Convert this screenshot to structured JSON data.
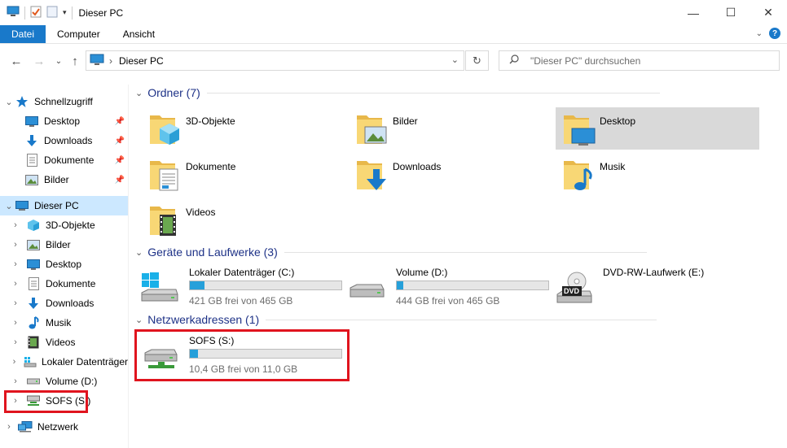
{
  "window": {
    "title": "Dieser PC",
    "controls": {
      "minimize": "—",
      "maximize": "☐",
      "close": "✕"
    }
  },
  "ribbon": {
    "tabs": [
      {
        "label": "Datei",
        "active": true
      },
      {
        "label": "Computer",
        "active": false
      },
      {
        "label": "Ansicht",
        "active": false
      }
    ],
    "help_label": "?"
  },
  "address": {
    "path": "Dieser PC",
    "search_placeholder": "\"Dieser PC\" durchsuchen"
  },
  "sidebar": {
    "items": [
      {
        "label": "Schnellzugriff",
        "icon": "star-icon",
        "level": 0,
        "chevron": "open"
      },
      {
        "label": "Desktop",
        "icon": "desktop-icon",
        "level": 1,
        "pinned": true
      },
      {
        "label": "Downloads",
        "icon": "downloads-icon",
        "level": 1,
        "pinned": true
      },
      {
        "label": "Dokumente",
        "icon": "documents-icon",
        "level": 1,
        "pinned": true
      },
      {
        "label": "Bilder",
        "icon": "pictures-icon",
        "level": 1,
        "pinned": true
      },
      {
        "label": "Dieser PC",
        "icon": "computer-icon",
        "level": 0,
        "chevron": "open",
        "selected": true
      },
      {
        "label": "3D-Objekte",
        "icon": "3d-objects-icon",
        "level": 1,
        "chevron": "closed"
      },
      {
        "label": "Bilder",
        "icon": "pictures-icon",
        "level": 1,
        "chevron": "closed"
      },
      {
        "label": "Desktop",
        "icon": "desktop-icon",
        "level": 1,
        "chevron": "closed"
      },
      {
        "label": "Dokumente",
        "icon": "documents-icon",
        "level": 1,
        "chevron": "closed"
      },
      {
        "label": "Downloads",
        "icon": "downloads-icon",
        "level": 1,
        "chevron": "closed"
      },
      {
        "label": "Musik",
        "icon": "music-icon",
        "level": 1,
        "chevron": "closed"
      },
      {
        "label": "Videos",
        "icon": "videos-icon",
        "level": 1,
        "chevron": "closed"
      },
      {
        "label": "Lokaler Datenträger",
        "icon": "local-disk-icon",
        "level": 1,
        "chevron": "closed"
      },
      {
        "label": "Volume (D:)",
        "icon": "drive-icon",
        "level": 1,
        "chevron": "closed"
      },
      {
        "label": "SOFS (S:)",
        "icon": "network-drive-icon",
        "level": 1,
        "chevron": "closed",
        "highlighted": true
      },
      {
        "label": "Netzwerk",
        "icon": "network-icon",
        "level": 0,
        "chevron": "closed"
      }
    ]
  },
  "groups": {
    "folders": {
      "title": "Ordner (7)",
      "items": [
        {
          "label": "3D-Objekte",
          "icon": "3d-objects-icon"
        },
        {
          "label": "Bilder",
          "icon": "pictures-icon"
        },
        {
          "label": "Desktop",
          "icon": "desktop-icon",
          "selected": true
        },
        {
          "label": "Dokumente",
          "icon": "documents-icon"
        },
        {
          "label": "Downloads",
          "icon": "downloads-icon"
        },
        {
          "label": "Musik",
          "icon": "music-icon"
        },
        {
          "label": "Videos",
          "icon": "videos-icon"
        }
      ]
    },
    "drives": {
      "title": "Geräte und Laufwerke (3)",
      "items": [
        {
          "label": "Lokaler Datenträger (C:)",
          "free": "421 GB frei von 465 GB",
          "used_fraction": 0.095,
          "icon": "windows-drive-icon",
          "bar": true
        },
        {
          "label": "Volume (D:)",
          "free": "444 GB frei von 465 GB",
          "used_fraction": 0.045,
          "icon": "drive-icon",
          "bar": true
        },
        {
          "label": "DVD-RW-Laufwerk (E:)",
          "free": "",
          "icon": "dvd-drive-icon",
          "bar": false,
          "dvd_label": "DVD"
        }
      ]
    },
    "network": {
      "title": "Netzwerkadressen (1)",
      "items": [
        {
          "label": "SOFS (S:)",
          "free": "10,4 GB frei von 11,0 GB",
          "used_fraction": 0.055,
          "icon": "network-drive-icon",
          "bar": true,
          "highlighted": true
        }
      ]
    }
  },
  "colors": {
    "accent": "#1979ca",
    "selection": "#cce8ff",
    "group_title": "#1e3287",
    "bar_fill": "#26a0da",
    "highlight_border": "#e0141e",
    "folder": "#f8d775"
  }
}
